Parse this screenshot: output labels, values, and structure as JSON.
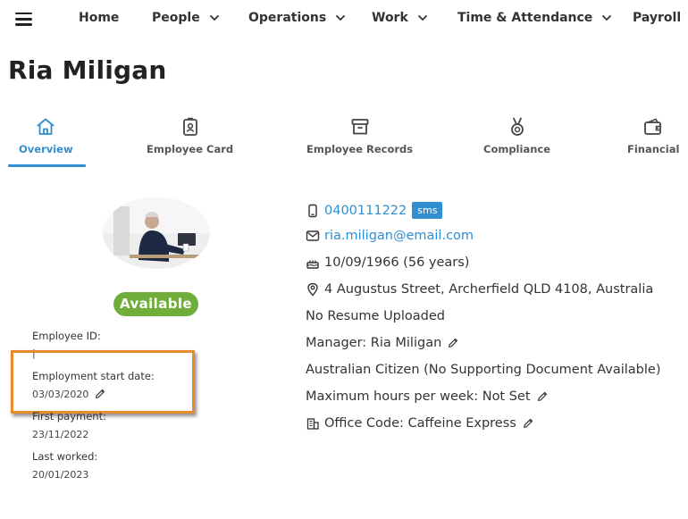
{
  "nav": {
    "items": [
      {
        "label": "Home",
        "has_dropdown": false
      },
      {
        "label": "People",
        "has_dropdown": true
      },
      {
        "label": "Operations",
        "has_dropdown": true
      },
      {
        "label": "Work",
        "has_dropdown": true
      },
      {
        "label": "Time & Attendance",
        "has_dropdown": true
      },
      {
        "label": "Payroll",
        "has_dropdown": true
      }
    ]
  },
  "page": {
    "title": "Ria Miligan"
  },
  "tabs": [
    {
      "label": "Overview",
      "icon": "home-icon",
      "active": true
    },
    {
      "label": "Employee Card",
      "icon": "id-badge-icon",
      "active": false
    },
    {
      "label": "Employee Records",
      "icon": "archive-box-icon",
      "active": false
    },
    {
      "label": "Compliance",
      "icon": "medal-icon",
      "active": false
    },
    {
      "label": "Financial",
      "icon": "wallet-icon",
      "active": false
    }
  ],
  "profile": {
    "status": "Available",
    "employee_id_label": "Employee ID:",
    "employee_id_value": "|",
    "start_date_label": "Employment start date:",
    "start_date_value": "03/03/2020",
    "first_payment_label": "First payment:",
    "first_payment_value": "23/11/2022",
    "last_worked_label": "Last worked:",
    "last_worked_value": "20/01/2023"
  },
  "details": {
    "phone": "0400111222",
    "sms_label": "sms",
    "email": "ria.miligan@email.com",
    "dob": "10/09/1966 (56 years)",
    "address": "4 Augustus Street, Archerfield QLD 4108, Australia",
    "resume": "No Resume Uploaded",
    "manager": "Manager: Ria Miligan",
    "citizenship": "Australian Citizen (No Supporting Document Available)",
    "max_hours": "Maximum hours per week: Not Set",
    "office_code": "Office Code: Caffeine Express"
  },
  "colors": {
    "accent": "#2f8fd0",
    "status_available": "#6fae3a",
    "highlight": "#e98a2d"
  }
}
